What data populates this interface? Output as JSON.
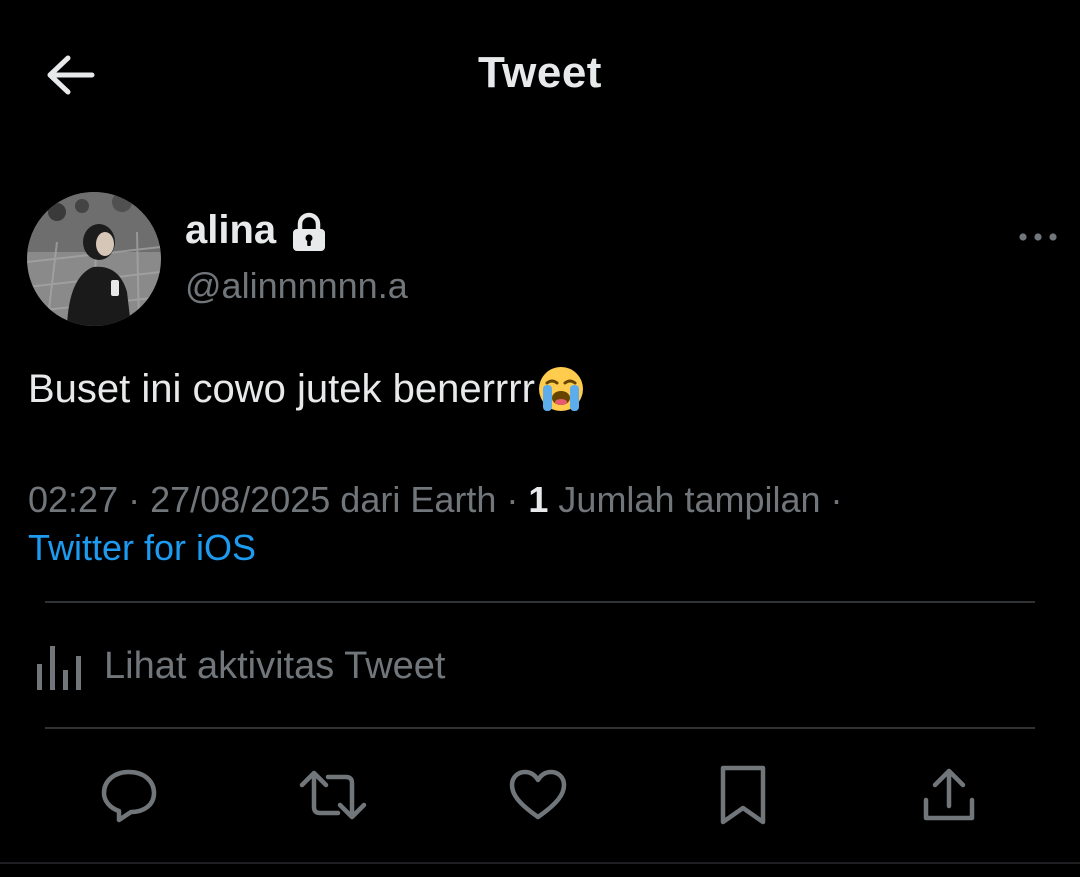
{
  "header": {
    "title": "Tweet",
    "back_icon": "arrow-left-icon"
  },
  "author": {
    "name": "alina",
    "handle": "@alinnnnnn.a",
    "protected_icon": "lock-icon",
    "avatar": "avatar-photo"
  },
  "tweet": {
    "text": "Buset ini cowo jutek benerrrr",
    "emoji": "loudly-crying-face"
  },
  "meta": {
    "time": "02:27",
    "date": "27/08/2025",
    "location": "dari Earth",
    "views_count": "1",
    "views_label": "Jumlah tampilan",
    "separator": " · ",
    "source": "Twitter for iOS"
  },
  "activity": {
    "label": "Lihat aktivitas Tweet",
    "icon": "analytics-bars-icon"
  },
  "actions": {
    "reply_icon": "reply-icon",
    "retweet_icon": "retweet-icon",
    "like_icon": "heart-icon",
    "bookmark_icon": "bookmark-icon",
    "share_icon": "share-icon"
  },
  "colors": {
    "background": "#000000",
    "primary_text": "#e7e9ea",
    "secondary_text": "#71767b",
    "link": "#1d9bf0",
    "divider": "#2f3336"
  }
}
